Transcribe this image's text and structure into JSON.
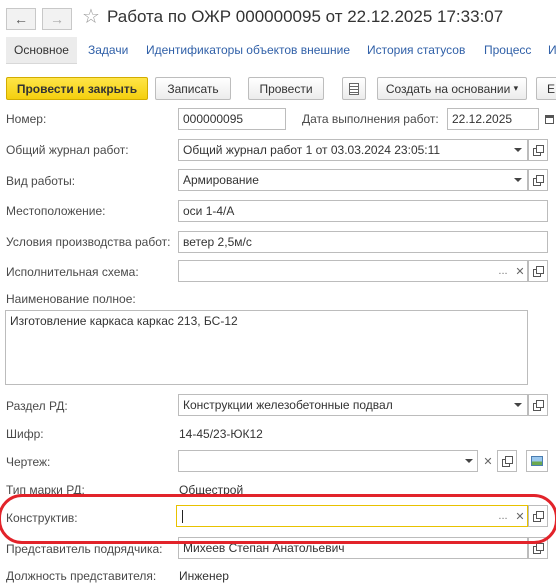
{
  "title": "Работа по ОЖР 000000095 от 22.12.2025 17:33:07",
  "tabs": [
    "Основное",
    "Задачи",
    "Идентификаторы объектов внешние",
    "История статусов",
    "Процесс",
    "И"
  ],
  "toolbar": {
    "post_close": "Провести и закрыть",
    "save": "Записать",
    "post": "Провести",
    "create_based": "Создать на основании",
    "more": "Е"
  },
  "form": {
    "number_label": "Номер:",
    "number_value": "000000095",
    "date_label": "Дата выполнения работ:",
    "date_value": "22.12.2025",
    "journal_label": "Общий журнал работ:",
    "journal_value": "Общий журнал работ 1 от 03.03.2024 23:05:11",
    "worktype_label": "Вид работы:",
    "worktype_value": "Армирование",
    "location_label": "Местоположение:",
    "location_value": "оси 1-4/А",
    "conditions_label": "Условия производства работ:",
    "conditions_value": "ветер 2,5м/с",
    "scheme_label": "Исполнительная схема:",
    "scheme_value": "",
    "fullname_label": "Наименование полное:",
    "fullname_value": "Изготовление каркаса каркас 213, БС-12",
    "section_label": "Раздел РД:",
    "section_value": "Конструкции железобетонные подвал",
    "cipher_label": "Шифр:",
    "cipher_value": "14-45/23-ЮК12",
    "drawing_label": "Чертеж:",
    "drawing_value": "",
    "rdtype_label": "Тип марки РД:",
    "rdtype_value": "Общестрой",
    "construct_label": "Конструктив:",
    "construct_value": "",
    "rep_label": "Представитель подрядчика:",
    "rep_value": "Михеев Степан Анатольевич",
    "position_label": "Должность представителя:",
    "position_value": "Инженер"
  },
  "colors": {
    "primary_button": "#f4cf0e",
    "highlight": "#e2232a",
    "focus_border": "#e8c200",
    "link": "#3060a8"
  }
}
